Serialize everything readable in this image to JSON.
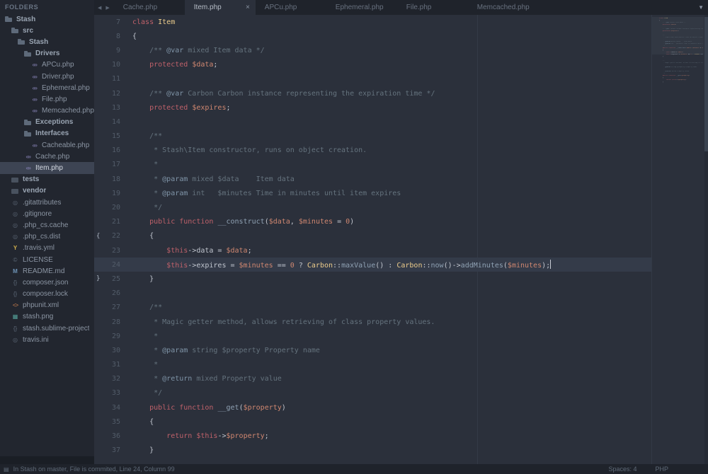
{
  "sidebar": {
    "header": "FOLDERS",
    "items": [
      {
        "label": "Stash",
        "level": 0,
        "folder": true,
        "icon": "folder-icon"
      },
      {
        "label": "src",
        "level": 1,
        "folder": true,
        "icon": "folder-icon"
      },
      {
        "label": "Stash",
        "level": 2,
        "folder": true,
        "icon": "folder-icon"
      },
      {
        "label": "Drivers",
        "level": 3,
        "folder": true,
        "icon": "folder-icon"
      },
      {
        "label": "APCu.php",
        "level": 4,
        "folder": false,
        "icon": "php-file-icon"
      },
      {
        "label": "Driver.php",
        "level": 4,
        "folder": false,
        "icon": "php-file-icon"
      },
      {
        "label": "Ephemeral.php",
        "level": 4,
        "folder": false,
        "icon": "php-file-icon"
      },
      {
        "label": "File.php",
        "level": 4,
        "folder": false,
        "icon": "php-file-icon"
      },
      {
        "label": "Memcached.php",
        "level": 4,
        "folder": false,
        "icon": "php-file-icon"
      },
      {
        "label": "Exceptions",
        "level": 3,
        "folder": true,
        "icon": "folder-icon"
      },
      {
        "label": "Interfaces",
        "level": 3,
        "folder": true,
        "icon": "folder-icon"
      },
      {
        "label": "Cacheable.php",
        "level": 4,
        "folder": false,
        "icon": "php-file-icon"
      },
      {
        "label": "Cache.php",
        "level": 3,
        "folder": false,
        "icon": "php-file-icon"
      },
      {
        "label": "Item.php",
        "level": 3,
        "folder": false,
        "icon": "php-file-icon",
        "selected": true
      },
      {
        "label": "tests",
        "level": 1,
        "folder": true,
        "icon": "package-folder-icon"
      },
      {
        "label": "vendor",
        "level": 1,
        "folder": true,
        "icon": "package-folder-icon"
      },
      {
        "label": ".gitattributes",
        "level": 1,
        "folder": false,
        "icon": "config-file-icon"
      },
      {
        "label": ".gitignore",
        "level": 1,
        "folder": false,
        "icon": "config-file-icon"
      },
      {
        "label": ".php_cs.cache",
        "level": 1,
        "folder": false,
        "icon": "config-file-icon"
      },
      {
        "label": ".php_cs.dist",
        "level": 1,
        "folder": false,
        "icon": "config-file-icon"
      },
      {
        "label": ".travis.yml",
        "level": 1,
        "folder": false,
        "icon": "yaml-file-icon"
      },
      {
        "label": "LICENSE",
        "level": 1,
        "folder": false,
        "icon": "license-file-icon"
      },
      {
        "label": "README.md",
        "level": 1,
        "folder": false,
        "icon": "markdown-file-icon"
      },
      {
        "label": "composer.json",
        "level": 1,
        "folder": false,
        "icon": "json-file-icon"
      },
      {
        "label": "composer.lock",
        "level": 1,
        "folder": false,
        "icon": "json-file-icon"
      },
      {
        "label": "phpunit.xml",
        "level": 1,
        "folder": false,
        "icon": "xml-file-icon"
      },
      {
        "label": "stash.png",
        "level": 1,
        "folder": false,
        "icon": "image-file-icon"
      },
      {
        "label": "stash.sublime-project",
        "level": 1,
        "folder": false,
        "icon": "project-file-icon"
      },
      {
        "label": "travis.ini",
        "level": 1,
        "folder": false,
        "icon": "ini-file-icon"
      }
    ]
  },
  "tab_bar": {
    "back_icon": "◀",
    "forward_icon": "▶",
    "overflow_icon": "▼",
    "tabs": [
      {
        "label": "Cache.php",
        "active": false
      },
      {
        "label": "Item.php",
        "active": true,
        "close_label": "×"
      },
      {
        "label": "APCu.php",
        "active": false
      },
      {
        "label": "Ephemeral.php",
        "active": false
      },
      {
        "label": "File.php",
        "active": false
      },
      {
        "label": "Memcached.php",
        "active": false
      }
    ]
  },
  "editor": {
    "current_line": 24,
    "cursor": {
      "line": 24,
      "column": 99
    },
    "lines": [
      {
        "n": 7,
        "fold": "",
        "toks": [
          [
            "k",
            "class"
          ],
          [
            "p",
            " "
          ],
          [
            "t",
            "Item"
          ]
        ]
      },
      {
        "n": 8,
        "fold": "",
        "toks": [
          [
            "p",
            "{"
          ]
        ]
      },
      {
        "n": 9,
        "fold": "",
        "toks": [
          [
            "c",
            "    /** "
          ],
          [
            "d",
            "@var"
          ],
          [
            "c",
            " mixed Item data */"
          ]
        ]
      },
      {
        "n": 10,
        "fold": "",
        "toks": [
          [
            "p",
            "    "
          ],
          [
            "k",
            "protected"
          ],
          [
            "p",
            " "
          ],
          [
            "v",
            "$data"
          ],
          [
            "p",
            ";"
          ]
        ]
      },
      {
        "n": 11,
        "fold": "",
        "toks": []
      },
      {
        "n": 12,
        "fold": "",
        "toks": [
          [
            "c",
            "    /** "
          ],
          [
            "d",
            "@var"
          ],
          [
            "c",
            " Carbon Carbon instance representing the expiration time */"
          ]
        ]
      },
      {
        "n": 13,
        "fold": "",
        "toks": [
          [
            "p",
            "    "
          ],
          [
            "k",
            "protected"
          ],
          [
            "p",
            " "
          ],
          [
            "v",
            "$expires"
          ],
          [
            "p",
            ";"
          ]
        ]
      },
      {
        "n": 14,
        "fold": "",
        "toks": []
      },
      {
        "n": 15,
        "fold": "",
        "toks": [
          [
            "c",
            "    /**"
          ]
        ]
      },
      {
        "n": 16,
        "fold": "",
        "toks": [
          [
            "c",
            "     * Stash\\Item constructor, runs on object creation."
          ]
        ]
      },
      {
        "n": 17,
        "fold": "",
        "toks": [
          [
            "c",
            "     *"
          ]
        ]
      },
      {
        "n": 18,
        "fold": "",
        "toks": [
          [
            "c",
            "     * "
          ],
          [
            "d",
            "@param"
          ],
          [
            "c",
            " mixed $data    Item data"
          ]
        ]
      },
      {
        "n": 19,
        "fold": "",
        "toks": [
          [
            "c",
            "     * "
          ],
          [
            "d",
            "@param"
          ],
          [
            "c",
            " int   $minutes Time in minutes until item expires"
          ]
        ]
      },
      {
        "n": 20,
        "fold": "",
        "toks": [
          [
            "c",
            "     */"
          ]
        ]
      },
      {
        "n": 21,
        "fold": "",
        "toks": [
          [
            "p",
            "    "
          ],
          [
            "k",
            "public"
          ],
          [
            "p",
            " "
          ],
          [
            "k",
            "function"
          ],
          [
            "p",
            " "
          ],
          [
            "f",
            "__construct"
          ],
          [
            "p",
            "("
          ],
          [
            "v",
            "$data"
          ],
          [
            "p",
            ", "
          ],
          [
            "v",
            "$minutes"
          ],
          [
            "p",
            " = "
          ],
          [
            "n",
            "0"
          ],
          [
            "p",
            ")"
          ]
        ]
      },
      {
        "n": 22,
        "fold": "{",
        "toks": [
          [
            "p",
            "    {"
          ]
        ]
      },
      {
        "n": 23,
        "fold": "",
        "toks": [
          [
            "p",
            "        "
          ],
          [
            "k",
            "$this"
          ],
          [
            "p",
            "->data = "
          ],
          [
            "v",
            "$data"
          ],
          [
            "p",
            ";"
          ]
        ]
      },
      {
        "n": 24,
        "fold": "",
        "toks": [
          [
            "p",
            "        "
          ],
          [
            "k",
            "$this"
          ],
          [
            "p",
            "->expires = "
          ],
          [
            "v",
            "$minutes"
          ],
          [
            "p",
            " == "
          ],
          [
            "n",
            "0"
          ],
          [
            "p",
            " ? "
          ],
          [
            "t",
            "Carbon"
          ],
          [
            "p",
            "::"
          ],
          [
            "f",
            "maxValue"
          ],
          [
            "p",
            "() : "
          ],
          [
            "t",
            "Carbon"
          ],
          [
            "p",
            "::"
          ],
          [
            "f",
            "now"
          ],
          [
            "p",
            "()->"
          ],
          [
            "f",
            "addMinutes"
          ],
          [
            "p",
            "("
          ],
          [
            "v",
            "$minutes"
          ],
          [
            "p",
            ");"
          ]
        ]
      },
      {
        "n": 25,
        "fold": "}",
        "toks": [
          [
            "p",
            "    }"
          ]
        ]
      },
      {
        "n": 26,
        "fold": "",
        "toks": []
      },
      {
        "n": 27,
        "fold": "",
        "toks": [
          [
            "c",
            "    /**"
          ]
        ]
      },
      {
        "n": 28,
        "fold": "",
        "toks": [
          [
            "c",
            "     * Magic getter method, allows retrieving of class property values."
          ]
        ]
      },
      {
        "n": 29,
        "fold": "",
        "toks": [
          [
            "c",
            "     *"
          ]
        ]
      },
      {
        "n": 30,
        "fold": "",
        "toks": [
          [
            "c",
            "     * "
          ],
          [
            "d",
            "@param"
          ],
          [
            "c",
            " string $property Property name"
          ]
        ]
      },
      {
        "n": 31,
        "fold": "",
        "toks": [
          [
            "c",
            "     *"
          ]
        ]
      },
      {
        "n": 32,
        "fold": "",
        "toks": [
          [
            "c",
            "     * "
          ],
          [
            "d",
            "@return"
          ],
          [
            "c",
            " mixed Property value"
          ]
        ]
      },
      {
        "n": 33,
        "fold": "",
        "toks": [
          [
            "c",
            "     */"
          ]
        ]
      },
      {
        "n": 34,
        "fold": "",
        "toks": [
          [
            "p",
            "    "
          ],
          [
            "k",
            "public"
          ],
          [
            "p",
            " "
          ],
          [
            "k",
            "function"
          ],
          [
            "p",
            " "
          ],
          [
            "f",
            "__get"
          ],
          [
            "p",
            "("
          ],
          [
            "v",
            "$property"
          ],
          [
            "p",
            ")"
          ]
        ]
      },
      {
        "n": 35,
        "fold": "",
        "toks": [
          [
            "p",
            "    {"
          ]
        ]
      },
      {
        "n": 36,
        "fold": "",
        "toks": [
          [
            "p",
            "        "
          ],
          [
            "k",
            "return"
          ],
          [
            "p",
            " "
          ],
          [
            "k",
            "$this"
          ],
          [
            "p",
            "->"
          ],
          [
            "v",
            "$property"
          ],
          [
            "p",
            ";"
          ]
        ]
      },
      {
        "n": 37,
        "fold": "",
        "toks": [
          [
            "p",
            "    }"
          ]
        ]
      }
    ]
  },
  "status_bar": {
    "icon": "▤",
    "left_text": "In Stash on master, File is commited, Line 24, Column 99",
    "spaces_label": "Spaces: 4",
    "syntax_label": "PHP"
  },
  "colors": {
    "editor_bg": "#2b303b",
    "sidebar_bg": "#22262f",
    "chrome_bg": "#1f232b",
    "selection_row": "#3d4453",
    "line_highlight": "#343b49",
    "text": "#c0c5ce",
    "comment": "#65737e",
    "keyword": "#bf616a",
    "class_name": "#ebcb8b",
    "variable": "#d08770",
    "function_name": "#8fa1b3"
  }
}
